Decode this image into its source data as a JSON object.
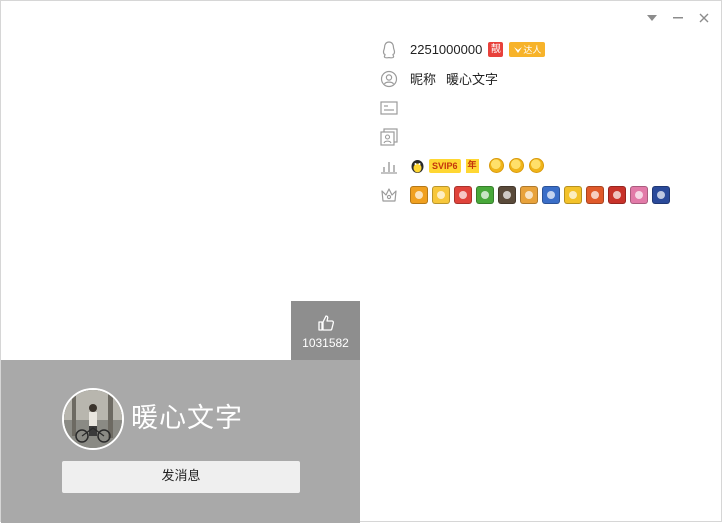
{
  "window": {
    "controls": [
      {
        "name": "dropdown-icon"
      },
      {
        "name": "minimize-icon"
      },
      {
        "name": "close-icon"
      }
    ]
  },
  "profile": {
    "display_name": "暖心文字",
    "likes": "1031582",
    "send_message_label": "发消息"
  },
  "info": {
    "qq_number": "2251000000",
    "pretty_badge": "靓",
    "daren_badge": "达人",
    "nickname_label": "昵称",
    "nickname_value": "暖心文字",
    "svip_label": "SVIP6",
    "year_label": "年",
    "level_suns": 3
  },
  "badges": [
    {
      "name": "badge-1",
      "color": "#f0a020"
    },
    {
      "name": "badge-2",
      "color": "#f7c73b"
    },
    {
      "name": "badge-3",
      "color": "#e0433b"
    },
    {
      "name": "badge-4",
      "color": "#48a83a"
    },
    {
      "name": "badge-5",
      "color": "#5a4a3a"
    },
    {
      "name": "badge-6",
      "color": "#e8a23b"
    },
    {
      "name": "badge-7",
      "color": "#3a6ec8"
    },
    {
      "name": "badge-8",
      "color": "#f3c22a"
    },
    {
      "name": "badge-9",
      "color": "#e05a2a"
    },
    {
      "name": "badge-10",
      "color": "#c8322a"
    },
    {
      "name": "badge-11",
      "color": "#e27aa8"
    },
    {
      "name": "badge-12",
      "color": "#2a4a9a"
    }
  ],
  "colors": {
    "panel_gray": "#a9a9a9",
    "like_box": "#8e8e8e",
    "icon_gray": "#9b9b9b"
  }
}
